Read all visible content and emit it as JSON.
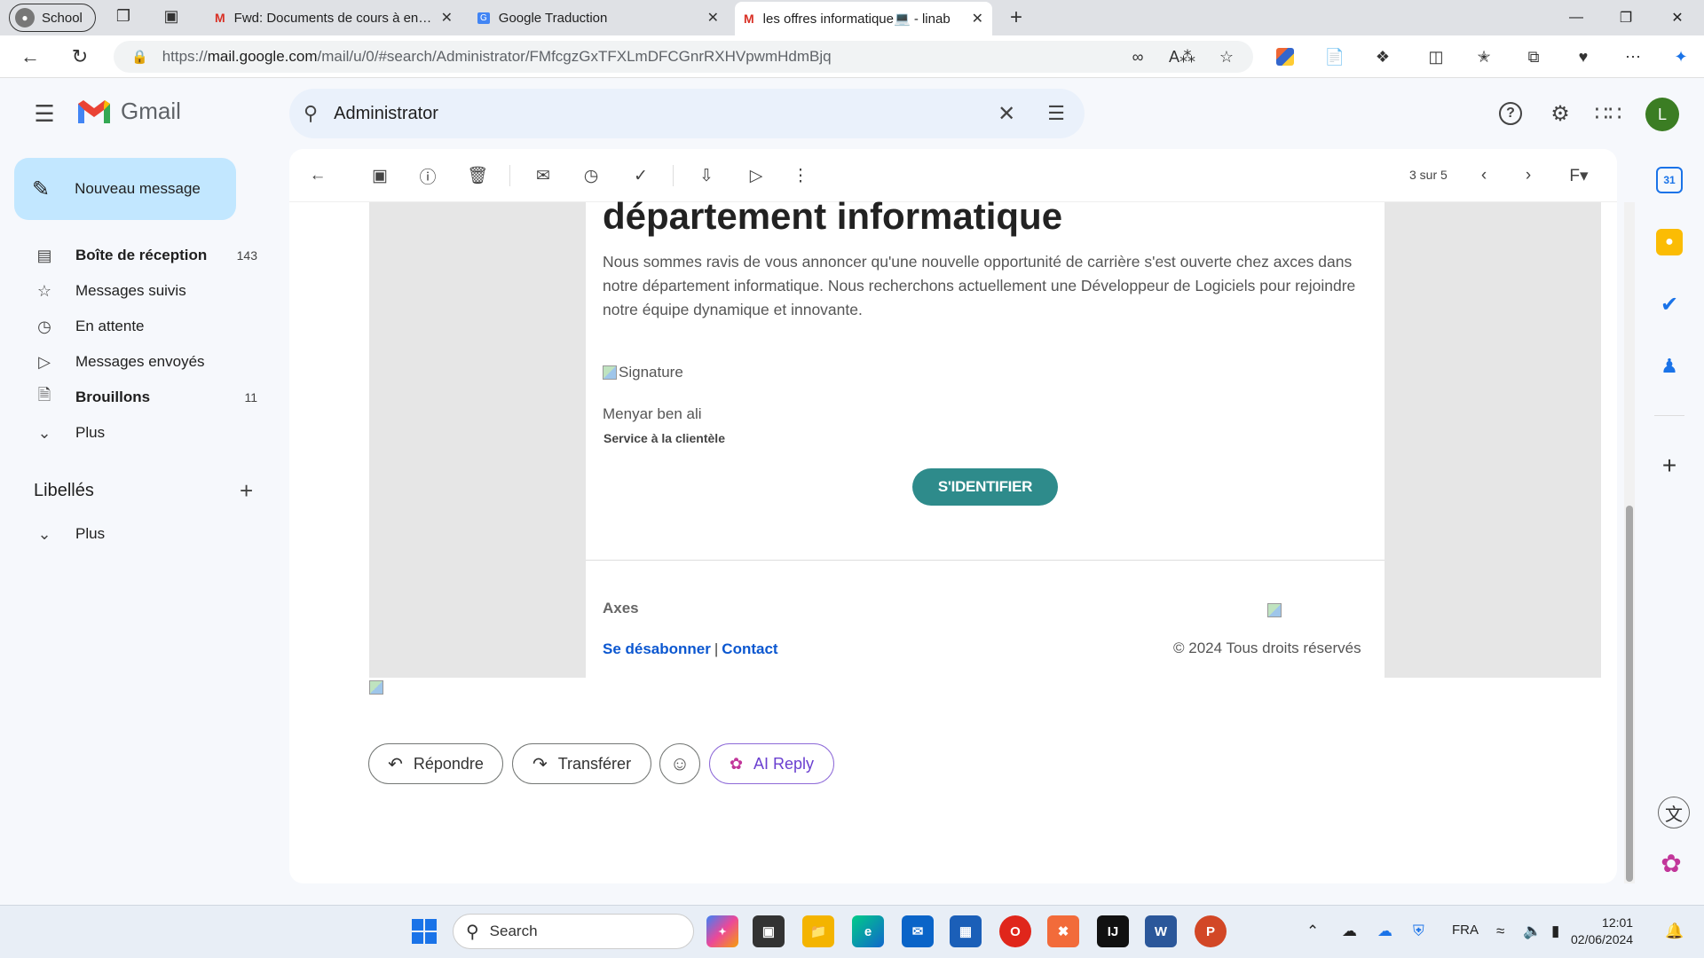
{
  "browser": {
    "profile": "School",
    "tabs": [
      {
        "title": "Fwd: Documents de cours à envo",
        "active": false
      },
      {
        "title": "Google Traduction",
        "active": false
      },
      {
        "title": "les offres informatique💻 - linab",
        "active": true
      }
    ],
    "url_prefix": "https://",
    "url_host": "mail.google.com",
    "url_path": "/mail/u/0/#search/Administrator/FMfcgzGxTFXLmDFCGnrRXHVpwmHdmBjq"
  },
  "gmail": {
    "brand": "Gmail",
    "search_value": "Administrator",
    "user_initial": "L",
    "compose_label": "Nouveau message",
    "nav": [
      {
        "label": "Boîte de réception",
        "count": "143",
        "icon": "inbox-icon",
        "bold": true
      },
      {
        "label": "Messages suivis",
        "count": "",
        "icon": "star-icon",
        "bold": false
      },
      {
        "label": "En attente",
        "count": "",
        "icon": "clock-icon",
        "bold": false
      },
      {
        "label": "Messages envoyés",
        "count": "",
        "icon": "send-icon",
        "bold": false
      },
      {
        "label": "Brouillons",
        "count": "11",
        "icon": "draft-icon",
        "bold": true
      },
      {
        "label": "Plus",
        "count": "",
        "icon": "chevron-down-icon",
        "bold": false
      }
    ],
    "labels_title": "Libellés",
    "labels_more": "Plus",
    "pager": "3 sur 5"
  },
  "email": {
    "heading": "département informatique",
    "paragraph": "Nous sommes ravis de vous annoncer qu'une nouvelle opportunité de carrière s'est ouverte chez axces dans notre département informatique. Nous recherchons actuellement une Développeur de Logiciels pour rejoindre notre équipe dynamique et innovante.",
    "signature_alt": "Signature",
    "sender_name": "Menyar ben ali",
    "sender_role": "Service à la clientèle",
    "login_button": "S'IDENTIFIER",
    "company": "Axes",
    "unsubscribe": "Se désabonner",
    "separator": "|",
    "contact": "Contact",
    "copyright": "© 2024 Tous droits réservés"
  },
  "actions": {
    "reply": "Répondre",
    "forward": "Transférer",
    "ai_reply": "AI Reply"
  },
  "taskbar": {
    "search_placeholder": "Search",
    "language": "FRA",
    "time": "12:01",
    "date": "02/06/2024"
  },
  "colors": {
    "compose_bg": "#c2e7ff",
    "login_button": "#2e8b8b",
    "link": "#0b57d0",
    "ai_reply": "#6a3fd0"
  }
}
